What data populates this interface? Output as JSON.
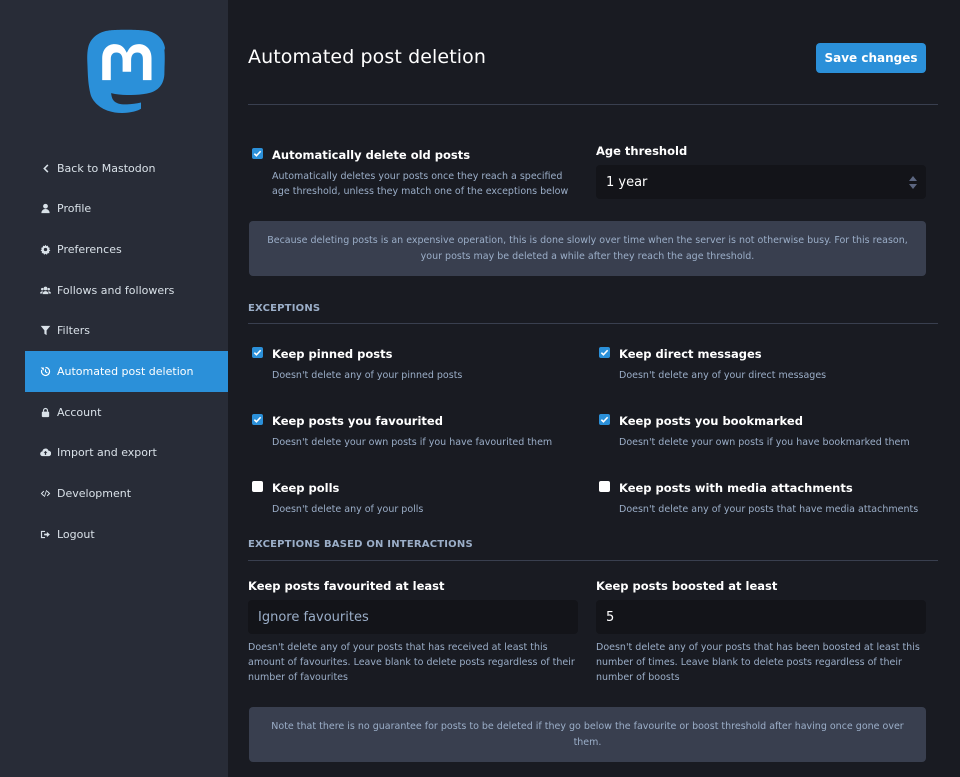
{
  "brand": {
    "accent": "#2b90d9",
    "logo_icon": "mastodon-logo-icon"
  },
  "sidebar": {
    "items": [
      {
        "label": "Back to Mastodon",
        "icon": "chevron-left-icon",
        "active": false
      },
      {
        "label": "Profile",
        "icon": "user-icon",
        "active": false
      },
      {
        "label": "Preferences",
        "icon": "gear-icon",
        "active": false
      },
      {
        "label": "Follows and followers",
        "icon": "users-icon",
        "active": false
      },
      {
        "label": "Filters",
        "icon": "filter-icon",
        "active": false
      },
      {
        "label": "Automated post deletion",
        "icon": "history-icon",
        "active": true
      },
      {
        "label": "Account",
        "icon": "lock-icon",
        "active": false
      },
      {
        "label": "Import and export",
        "icon": "cloud-icon",
        "active": false
      },
      {
        "label": "Development",
        "icon": "code-icon",
        "active": false
      },
      {
        "label": "Logout",
        "icon": "sign-out-icon",
        "active": false
      }
    ]
  },
  "header": {
    "title": "Automated post deletion",
    "save_label": "Save changes"
  },
  "auto_delete": {
    "label": "Automatically delete old posts",
    "hint": "Automatically deletes your posts once they reach a specified age threshold, unless they match one of the exceptions below",
    "checked": true
  },
  "age_threshold": {
    "label": "Age threshold",
    "value": "1 year"
  },
  "notice_slow": "Because deleting posts is an expensive operation, this is done slowly over time when the server is not otherwise busy. For this reason, your posts may be deleted a while after they reach the age threshold.",
  "exceptions": {
    "heading": "EXCEPTIONS",
    "items": [
      {
        "label": "Keep pinned posts",
        "hint": "Doesn't delete any of your pinned posts",
        "checked": true
      },
      {
        "label": "Keep direct messages",
        "hint": "Doesn't delete any of your direct messages",
        "checked": true
      },
      {
        "label": "Keep posts you favourited",
        "hint": "Doesn't delete your own posts if you have favourited them",
        "checked": true
      },
      {
        "label": "Keep posts you bookmarked",
        "hint": "Doesn't delete your own posts if you have bookmarked them",
        "checked": true
      },
      {
        "label": "Keep polls",
        "hint": "Doesn't delete any of your polls",
        "checked": false
      },
      {
        "label": "Keep posts with media attachments",
        "hint": "Doesn't delete any of your posts that have media attachments",
        "checked": false
      }
    ]
  },
  "interactions": {
    "heading": "EXCEPTIONS BASED ON INTERACTIONS",
    "favourites": {
      "label": "Keep posts favourited at least",
      "placeholder": "Ignore favourites",
      "value": "",
      "hint": "Doesn't delete any of your posts that has received at least this amount of favourites. Leave blank to delete posts regardless of their number of favourites"
    },
    "boosts": {
      "label": "Keep posts boosted at least",
      "value": "5",
      "hint": "Doesn't delete any of your posts that has been boosted at least this number of times. Leave blank to delete posts regardless of their number of boosts"
    }
  },
  "notice_guarantee": "Note that there is no guarantee for posts to be deleted if they go below the favourite or boost threshold after having once gone over them."
}
